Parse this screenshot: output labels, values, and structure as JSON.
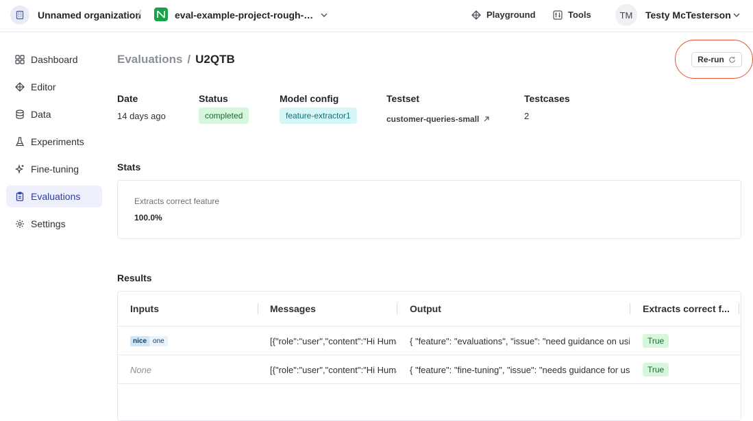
{
  "header": {
    "org_name": "Unnamed organization",
    "project_name": "eval-example-project-rough-lo...",
    "playground_label": "Playground",
    "tools_label": "Tools",
    "user_initials": "TM",
    "user_name": "Testy McTesterson"
  },
  "sidebar": {
    "items": [
      {
        "label": "Dashboard",
        "icon": "grid-icon"
      },
      {
        "label": "Editor",
        "icon": "diamond-icon"
      },
      {
        "label": "Data",
        "icon": "database-icon"
      },
      {
        "label": "Experiments",
        "icon": "flask-icon"
      },
      {
        "label": "Fine-tuning",
        "icon": "sparkle-icon"
      },
      {
        "label": "Evaluations",
        "icon": "clipboard-icon",
        "active": true
      },
      {
        "label": "Settings",
        "icon": "gear-icon"
      }
    ]
  },
  "page": {
    "breadcrumb_parent": "Evaluations",
    "breadcrumb_sep": "/",
    "breadcrumb_current": "U2QTB",
    "rerun_label": "Re-run"
  },
  "meta": {
    "date_label": "Date",
    "date_value": "14 days ago",
    "status_label": "Status",
    "status_value": "completed",
    "model_label": "Model config",
    "model_value": "feature-extractor1",
    "testset_label": "Testset",
    "testset_value": "customer-queries-small",
    "testcases_label": "Testcases",
    "testcases_value": "2"
  },
  "stats": {
    "title": "Stats",
    "label": "Extracts correct feature",
    "value": "100.0%"
  },
  "results": {
    "title": "Results",
    "columns": [
      "Inputs",
      "Messages",
      "Output",
      "Extracts correct f..."
    ],
    "rows": [
      {
        "input_tag_key": "nice",
        "input_tag_value": "one",
        "messages": "[{\"role\":\"user\",\"content\":\"Hi Human",
        "output": "{ \"feature\": \"evaluations\", \"issue\": \"need guidance on usi",
        "result": "True"
      },
      {
        "input_none": "None",
        "messages": "[{\"role\":\"user\",\"content\":\"Hi Human",
        "output": "{ \"feature\": \"fine-tuning\", \"issue\": \"needs guidance for us",
        "result": "True"
      }
    ]
  },
  "colors": {
    "accent": "#2b3ab0",
    "active_bg": "#eef1fb",
    "success_bg": "#d7f7dd",
    "highlight": "#e4542e"
  }
}
